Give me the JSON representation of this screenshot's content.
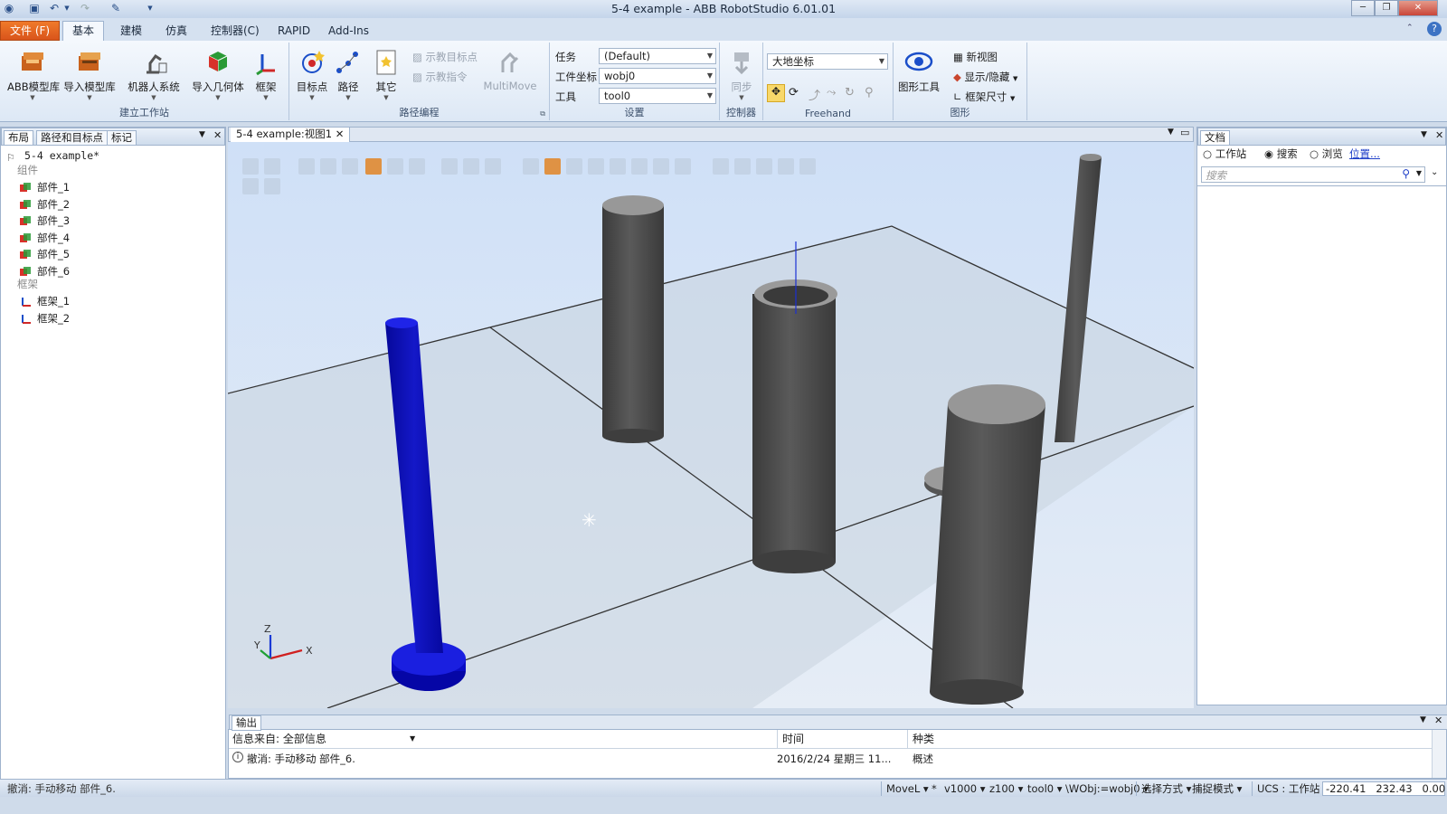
{
  "window": {
    "title": "5-4 example - ABB RobotStudio 6.01.01"
  },
  "tabs": [
    {
      "label": "文件 (F)"
    },
    {
      "label": "基本"
    },
    {
      "label": "建模"
    },
    {
      "label": "仿真"
    },
    {
      "label": "控制器(C)"
    },
    {
      "label": "RAPID"
    },
    {
      "label": "Add-Ins"
    }
  ],
  "ribbon": {
    "group_station": {
      "label": "建立工作站",
      "buttons": [
        {
          "label": "ABB模型库"
        },
        {
          "label": "导入模型库"
        },
        {
          "label": "机器人系统"
        },
        {
          "label": "导入几何体"
        },
        {
          "label": "框架"
        }
      ]
    },
    "group_path": {
      "label": "路径编程",
      "buttons": [
        {
          "label": "目标点"
        },
        {
          "label": "路径"
        },
        {
          "label": "其它"
        }
      ],
      "teach_target": "示教目标点",
      "teach_instruction": "示教指令",
      "multimove": "MultiMove"
    },
    "group_settings": {
      "label": "设置",
      "task_label": "任务",
      "task_value": "(Default)",
      "wobj_label": "工件坐标",
      "wobj_value": "wobj0",
      "tool_label": "工具",
      "tool_value": "tool0"
    },
    "group_controller": {
      "label": "控制器",
      "sync": "同步"
    },
    "group_freehand": {
      "label": "Freehand",
      "frame_value": "大地坐标"
    },
    "group_graphics": {
      "label": "图形",
      "tools": "图形工具",
      "new_view": "新视图",
      "show_hide": "显示/隐藏",
      "frame_size": "框架尺寸"
    }
  },
  "left_panel": {
    "tabs": [
      "布局",
      "路径和目标点",
      "标记"
    ],
    "station": "5-4 example*",
    "components_label": "组件",
    "components": [
      "部件_1",
      "部件_2",
      "部件_3",
      "部件_4",
      "部件_5",
      "部件_6"
    ],
    "frames_label": "框架",
    "frames": [
      "框架_1",
      "框架_2"
    ]
  },
  "view": {
    "tab_label": "5-4 example:视图1",
    "axis_x": "X",
    "axis_y": "Y",
    "axis_z": "Z"
  },
  "doc_panel": {
    "title": "文档",
    "radio_station": "工作站",
    "radio_search": "搜索",
    "radio_browse": "浏览",
    "location_link": "位置...",
    "search_placeholder": "搜索"
  },
  "output": {
    "title": "输出",
    "col_source": "信息来自: 全部信息",
    "col_time": "时间",
    "col_type": "种类",
    "rows": [
      {
        "message": "撤消: 手动移动 部件_6.",
        "time": "2016/2/24 星期三 11...",
        "type": "概述"
      }
    ]
  },
  "statusbar": {
    "left": "撤消: 手动移动 部件_6.",
    "movel": "MoveL",
    "star": "*",
    "speed": "v1000",
    "zone": "z100",
    "tool": "tool0",
    "wobj": "\\WObj:=wobj0",
    "select_mode": "选择方式",
    "snap_mode": "捕捉模式",
    "ucs": "UCS : 工作站",
    "coords": "-220.41   232.43   0.00"
  },
  "colors": {
    "accent": "#e8662a",
    "blue_part": "#0a10c0",
    "cylinder_dark": "#4a4a4a"
  }
}
